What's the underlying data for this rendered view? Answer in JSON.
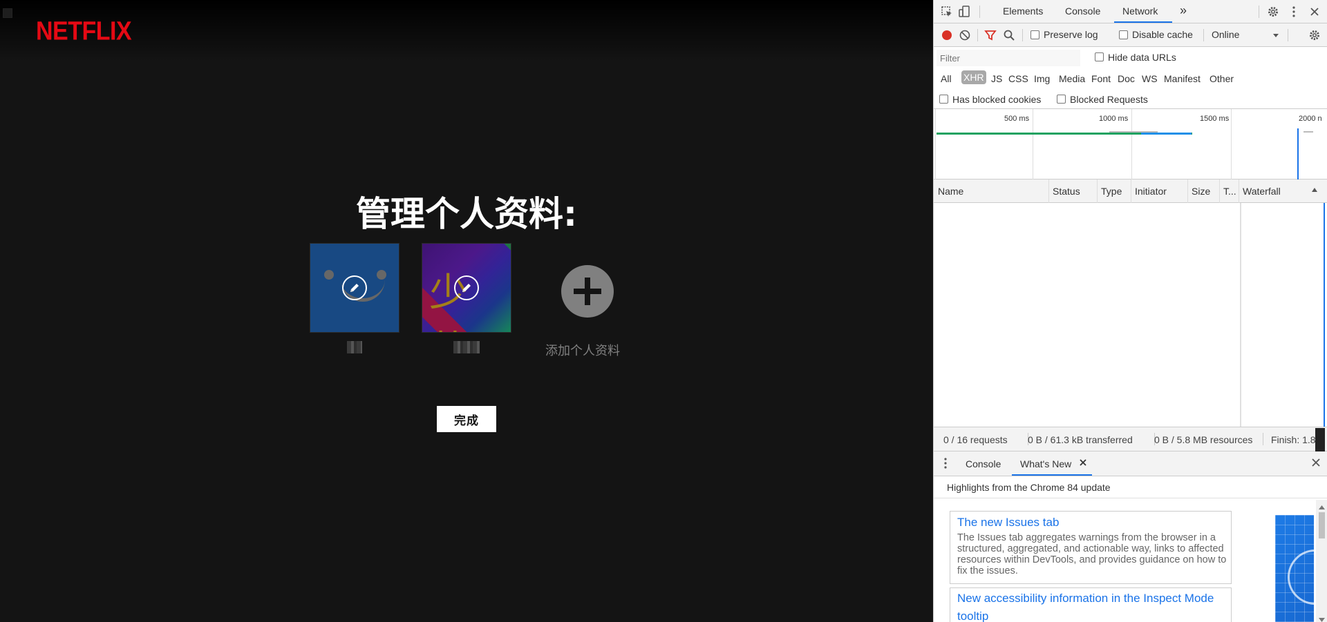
{
  "netflix": {
    "logo": "NETFLIX",
    "title": "管理个人资料:",
    "profiles": [
      {
        "name": "",
        "avatar": "blue-smiley"
      },
      {
        "name": "",
        "avatar": "kids",
        "avatar_text": "少儿"
      }
    ],
    "add_profile_label": "添加个人资料",
    "done_label": "完成"
  },
  "devtools": {
    "tabs": [
      "Elements",
      "Console",
      "Network"
    ],
    "active_tab": "Network",
    "more_tabs": "»",
    "toolbar": {
      "preserve_log": "Preserve log",
      "disable_cache": "Disable cache",
      "throttle": "Online"
    },
    "filter": {
      "placeholder": "Filter",
      "hide_data_urls": "Hide data URLs"
    },
    "types": [
      "All",
      "XHR",
      "JS",
      "CSS",
      "Img",
      "Media",
      "Font",
      "Doc",
      "WS",
      "Manifest",
      "Other"
    ],
    "active_type": "XHR",
    "blocked": {
      "has_blocked_cookies": "Has blocked cookies",
      "blocked_requests": "Blocked Requests"
    },
    "overview_ticks": [
      "500 ms",
      "1000 ms",
      "1500 ms",
      "2000 n"
    ],
    "columns": [
      "Name",
      "Status",
      "Type",
      "Initiator",
      "Size",
      "T...",
      "Waterfall"
    ],
    "status_bar": {
      "requests": "0 / 16 requests",
      "transferred": "0 B / 61.3 kB transferred",
      "resources": "0 B / 5.8 MB resources",
      "finish": "Finish: 1.8"
    },
    "drawer": {
      "tabs": [
        "Console",
        "What's New"
      ],
      "active": "What's New",
      "header": "Highlights from the Chrome 84 update",
      "cards": [
        {
          "title": "The new Issues tab",
          "body": "The Issues tab aggregates warnings from the browser in a structured, aggregated, and actionable way, links to affected resources within DevTools, and provides guidance on how to fix the issues."
        },
        {
          "title": "New accessibility information in the Inspect Mode tooltip",
          "body": ""
        }
      ]
    }
  },
  "colors": {
    "netflix_red": "#e50914",
    "netflix_bg": "#141414",
    "devtools_blue": "#1a73e8",
    "record_red": "#d93025"
  }
}
